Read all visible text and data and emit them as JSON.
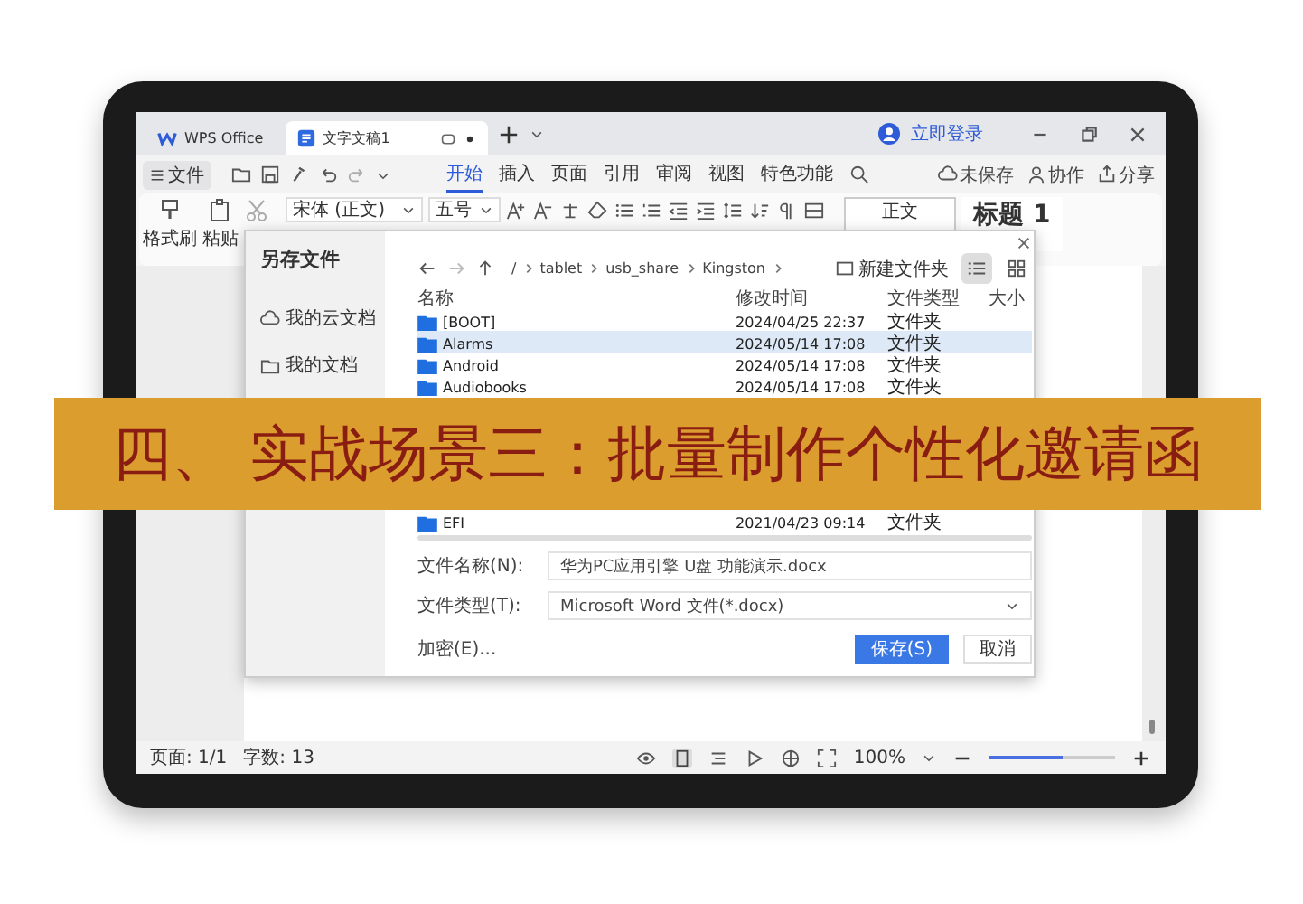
{
  "tabs": [
    {
      "label": "WPS Office",
      "kind": "app",
      "selected": false
    },
    {
      "label": "文字文稿1",
      "kind": "doc",
      "selected": true
    }
  ],
  "account": {
    "label": "立即登录"
  },
  "menu": {
    "file": "文件",
    "tabs": [
      {
        "label": "开始",
        "selected": true
      },
      {
        "label": "插入",
        "selected": false
      },
      {
        "label": "页面",
        "selected": false
      },
      {
        "label": "引用",
        "selected": false
      },
      {
        "label": "审阅",
        "selected": false
      },
      {
        "label": "视图",
        "selected": false
      },
      {
        "label": "特色功能",
        "selected": false
      }
    ],
    "actions": [
      {
        "label": "未保存",
        "kind": "cloud"
      },
      {
        "label": "协作",
        "kind": "people"
      },
      {
        "label": "分享",
        "kind": "share"
      }
    ]
  },
  "ribbon": {
    "format_painter": "格式刷",
    "paste": "粘贴",
    "font": "宋体 (正文)",
    "size": "五号",
    "styles": [
      {
        "label": "正文",
        "kind": "body"
      },
      {
        "label": "标题 1",
        "kind": "heading"
      }
    ]
  },
  "dialog": {
    "title": "另存文件",
    "places": [
      {
        "label": "我的云文档",
        "kind": "cloud"
      },
      {
        "label": "我的文档",
        "kind": "folder"
      }
    ],
    "path": [
      "/",
      "tablet",
      "usb_share",
      "Kingston"
    ],
    "new_folder": "新建文件夹",
    "views": [
      {
        "kind": "list",
        "selected": true
      },
      {
        "kind": "grid",
        "selected": false
      }
    ],
    "columns": [
      "名称",
      "修改时间",
      "文件类型",
      "大小"
    ],
    "rows": [
      {
        "name": "[BOOT]",
        "modified": "2024/04/25 22:37",
        "type": "文件夹",
        "selected": false
      },
      {
        "name": "Alarms",
        "modified": "2024/05/14 17:08",
        "type": "文件夹",
        "selected": true
      },
      {
        "name": "Android",
        "modified": "2024/05/14 17:08",
        "type": "文件夹",
        "selected": false
      },
      {
        "name": "Audiobooks",
        "modified": "2024/05/14 17:08",
        "type": "文件夹",
        "selected": false
      }
    ],
    "lower_rows": [
      {
        "name": "EFI",
        "modified": "2021/04/23 09:14",
        "type": "文件夹",
        "selected": false
      }
    ],
    "filename": {
      "label": "文件名称(N):",
      "value": "华为PC应用引擎 U盘 功能演示.docx"
    },
    "filetype": {
      "label": "文件类型(T):",
      "value": "Microsoft Word 文件(*.docx)"
    },
    "encrypt": "加密(E)...",
    "buttons": [
      {
        "label": "保存(S)",
        "kind": "primary"
      },
      {
        "label": "取消",
        "kind": "secondary"
      }
    ]
  },
  "status_bar": {
    "page": "页面: 1/1",
    "words": "字数: 13",
    "zoom": "100%",
    "level": 0.58
  },
  "banner": {
    "title": "四、 实战场景三：批量制作个性化邀请函"
  }
}
